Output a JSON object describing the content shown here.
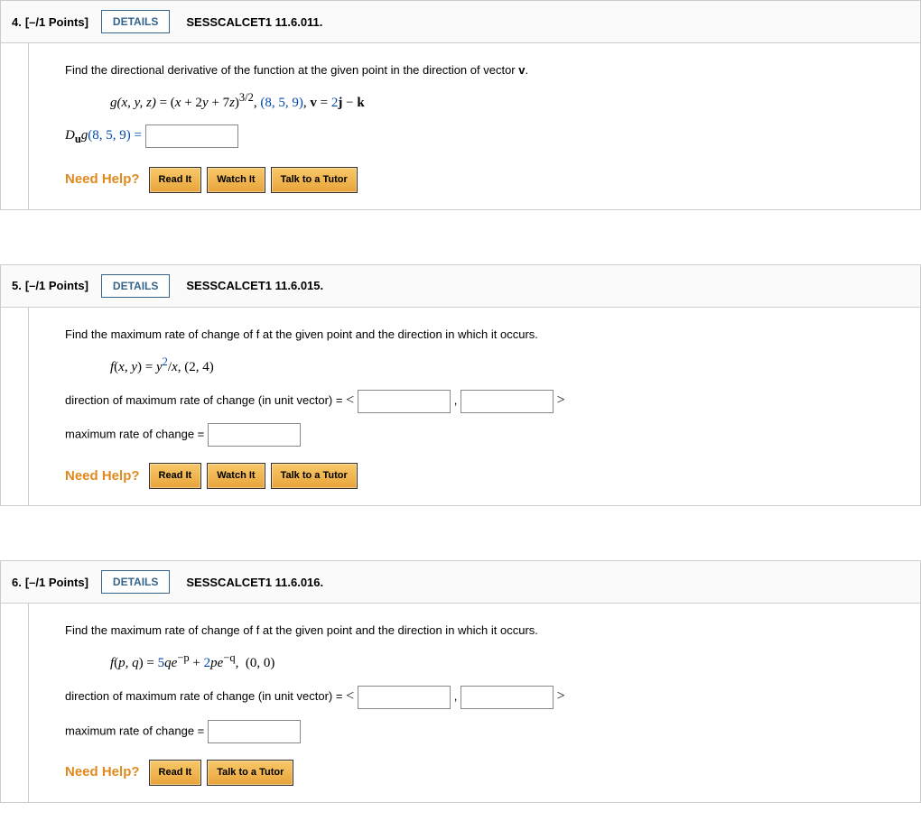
{
  "help_label": "Need Help?",
  "buttons": {
    "read": "Read It",
    "watch": "Watch It",
    "tutor": "Talk to a Tutor",
    "details": "DETAILS"
  },
  "q4": {
    "num": "4.",
    "points": "[–/1 Points]",
    "code": "SESSCALCET1 11.6.011.",
    "prompt": "Find the directional derivative of the function at the given point in the direction of vector ",
    "prompt_v": "v",
    "answer_label_pre": "D",
    "answer_label_sub": "u",
    "answer_label_g": "g",
    "answer_label_point": "(8, 5, 9) ="
  },
  "q5": {
    "num": "5.",
    "points": "[–/1 Points]",
    "code": "SESSCALCET1 11.6.015.",
    "prompt": "Find the maximum rate of change of f at the given point and the direction in which it occurs.",
    "dir_label": "direction of maximum rate of change (in unit vector) =",
    "max_label": "maximum rate of change ="
  },
  "q6": {
    "num": "6.",
    "points": "[–/1 Points]",
    "code": "SESSCALCET1 11.6.016.",
    "prompt": "Find the maximum rate of change of f at the given point and the direction in which it occurs.",
    "dir_label": "direction of maximum rate of change (in unit vector) =",
    "max_label": "maximum rate of change ="
  }
}
